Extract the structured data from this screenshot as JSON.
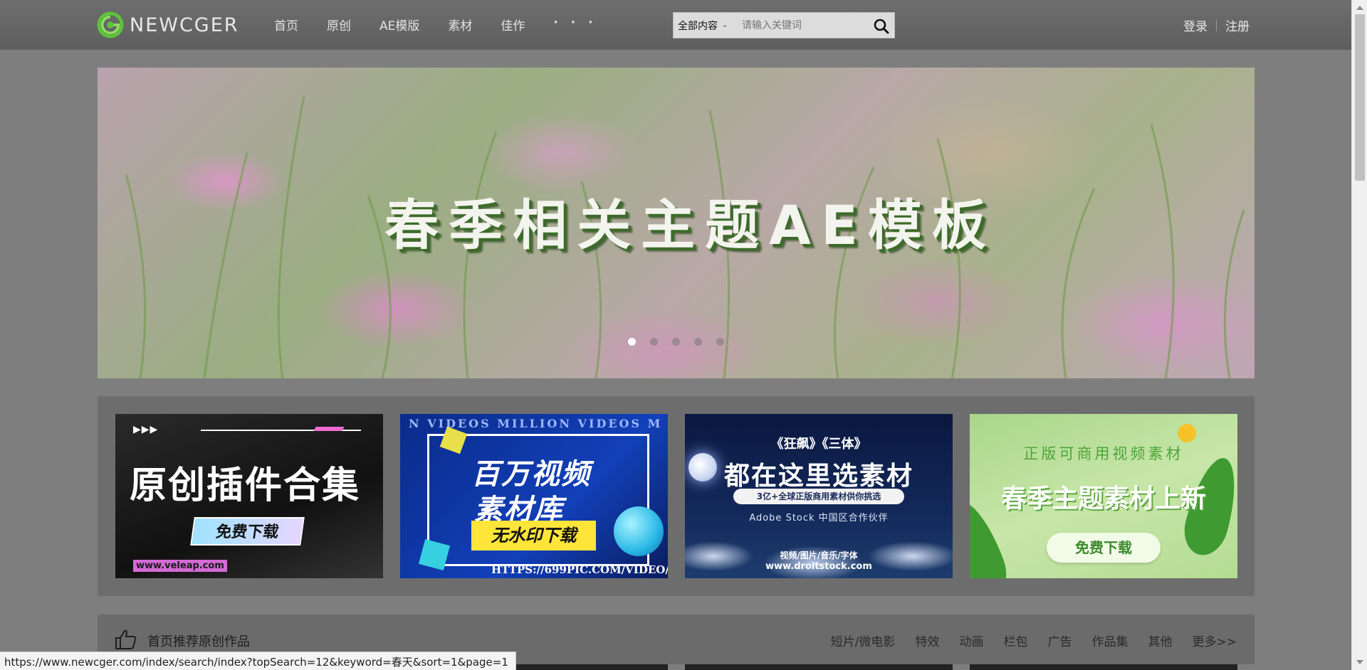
{
  "header": {
    "logo_text": "NEWCGER",
    "nav": [
      {
        "label": "首页"
      },
      {
        "label": "原创"
      },
      {
        "label": "AE模版"
      },
      {
        "label": "素材"
      },
      {
        "label": "佳作"
      },
      {
        "label": "· · ·"
      }
    ],
    "search": {
      "scope": "全部内容",
      "placeholder": "请输入关键词"
    },
    "login": "登录",
    "register": "注册"
  },
  "hero": {
    "title": "春季相关主题AE模板",
    "slides_total": 5,
    "active_slide": 1
  },
  "ads": [
    {
      "title": "原创插件合集",
      "button": "免费下载",
      "url": "www.veleap.com"
    },
    {
      "ring_text": "N VIDEOS MILLION VIDEOS M",
      "line1": "百万视频",
      "line2": "素材库",
      "button": "无水印下载",
      "url": "HTTPS://699PIC.COM/VIDEO/"
    },
    {
      "top": "《狂飙》《三体》",
      "title": "都在这里选素材",
      "pill": "3亿+全球正版商用素材供你挑选",
      "partner": "Adobe Stock 中国区合作伙伴",
      "sub": "视频/图片/音乐/字体",
      "url": "www.droitstock.com"
    },
    {
      "top": "正版可商用视频素材",
      "title": "春季主题素材上新",
      "button": "免费下载"
    }
  ],
  "recommend": {
    "title": "首页推荐原创作品",
    "tabs": [
      "短片/微电影",
      "特效",
      "动画",
      "栏包",
      "广告",
      "作品集",
      "其他",
      "更多>>"
    ]
  },
  "status_url": "https://www.newcger.com/index/search/index?topSearch=12&keyword=春天&sort=1&page=1",
  "colors": {
    "page_overlay": "#7e7e7e",
    "header": "#666666",
    "logo_green": "#5ec33a",
    "ad_yellow": "#ffe53a"
  }
}
